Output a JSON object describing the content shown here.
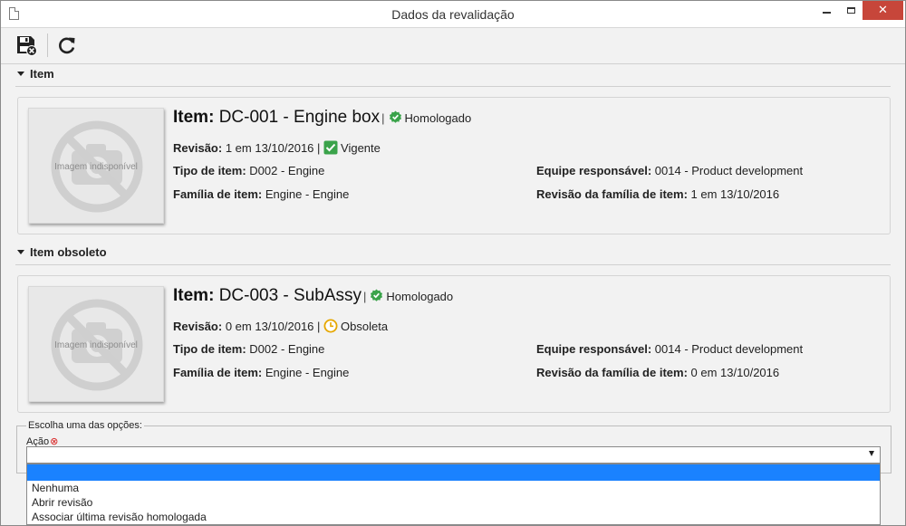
{
  "window": {
    "title": "Dados da revalidação"
  },
  "toolbar": {
    "buttons": [
      "save-close-icon",
      "refresh-icon"
    ]
  },
  "sections": [
    {
      "heading": "Item",
      "image_text": "Imagem indisponível",
      "title_label": "Item:",
      "title_value": "DC-001 - Engine box",
      "status": "Homologado",
      "revisao_label": "Revisão:",
      "revisao_value": "1 em 13/10/2016",
      "revisao_status": "Vigente",
      "tipo_label": "Tipo de item:",
      "tipo_value": "D002 - Engine",
      "familia_label": "Família de item:",
      "familia_value": "Engine - Engine",
      "equipe_label": "Equipe responsável:",
      "equipe_value": "0014 - Product development",
      "rev_familia_label": "Revisão da família de item:",
      "rev_familia_value": "1 em 13/10/2016"
    },
    {
      "heading": "Item obsoleto",
      "image_text": "Imagem indisponível",
      "title_label": "Item:",
      "title_value": "DC-003 - SubAssy",
      "status": "Homologado",
      "revisao_label": "Revisão:",
      "revisao_value": "0 em 13/10/2016",
      "revisao_status": "Obsoleta",
      "tipo_label": "Tipo de item:",
      "tipo_value": "D002 - Engine",
      "familia_label": "Família de item:",
      "familia_value": "Engine - Engine",
      "equipe_label": "Equipe responsável:",
      "equipe_value": "0014 - Product development",
      "rev_familia_label": "Revisão da família de item:",
      "rev_familia_value": "0 em 13/10/2016"
    }
  ],
  "options": {
    "legend": "Escolha uma das opções:",
    "acao_label": "Ação",
    "selected_value": "",
    "dropdown_options": [
      "",
      "Nenhuma",
      "Abrir revisão",
      "Associar última revisão homologada"
    ]
  },
  "colors": {
    "homologado": "#3aa34a",
    "vigente": "#3aa34a",
    "obsoleta": "#e6a700",
    "selected": "#1a82ff",
    "close": "#c7463a"
  }
}
